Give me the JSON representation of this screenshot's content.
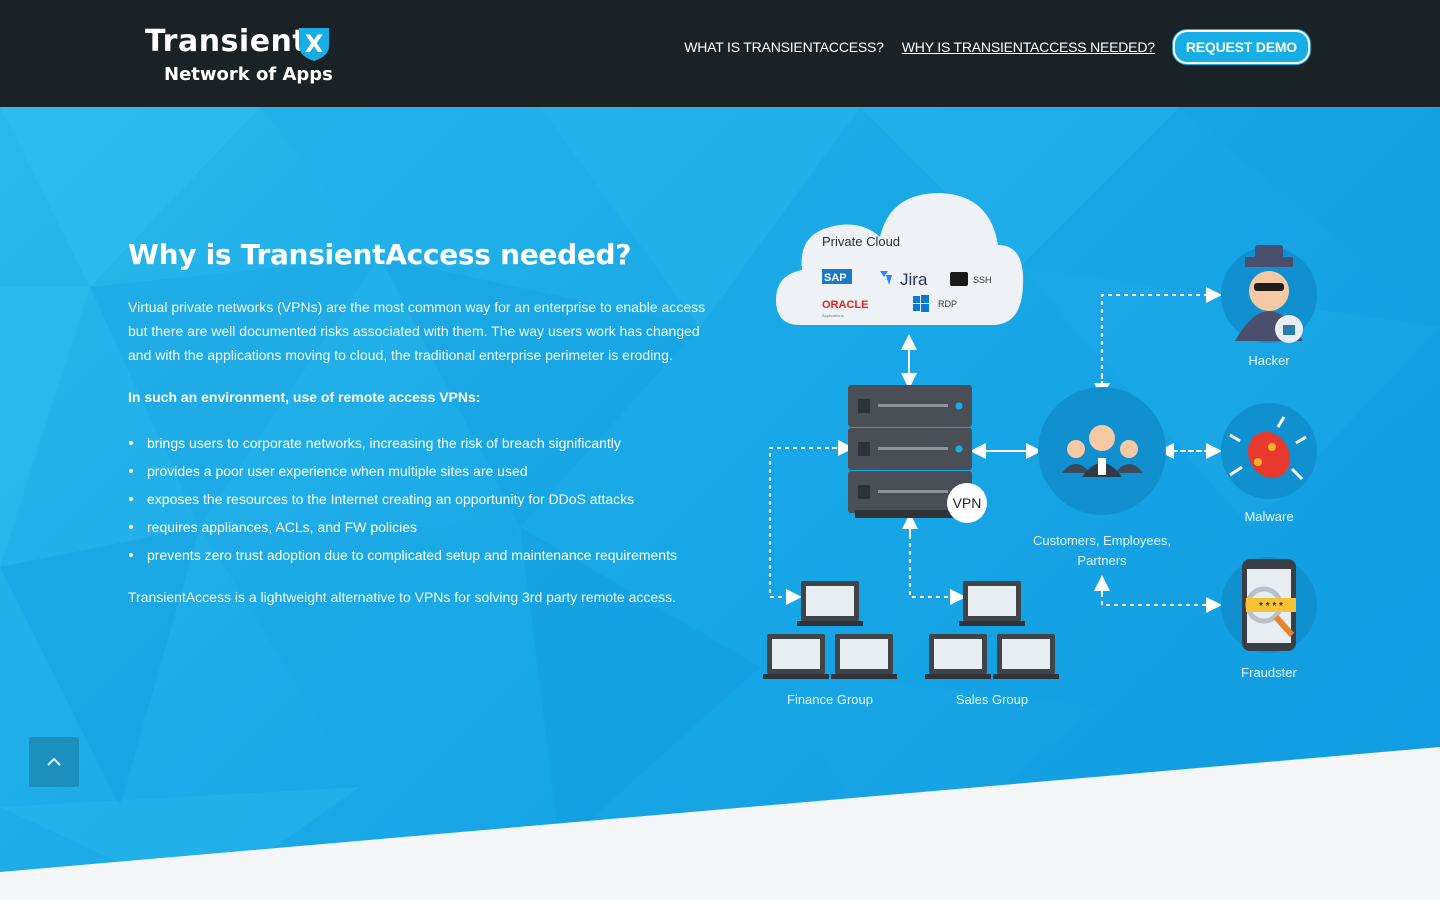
{
  "brand": {
    "name": "Transient",
    "x_mark": "X",
    "tagline": "Network of Apps"
  },
  "nav": {
    "items": [
      {
        "label": "WHAT IS TRANSIENTACCESS?"
      },
      {
        "label": "WHY IS TRANSIENTACCESS NEEDED?"
      }
    ],
    "cta": "REQUEST DEMO"
  },
  "section": {
    "title": "Why is TransientAccess needed?",
    "intro": "Virtual private networks (VPNs) are the most common way for an enterprise to enable access but there are well documented risks associated with them. The way users work has changed and with the applications moving to cloud, the traditional enterprise perimeter is eroding.",
    "subhead": "In such an environment, use of remote access VPNs:",
    "bullets": [
      "brings users to corporate networks, increasing the risk of breach significantly",
      "provides a poor user experience when multiple sites are used",
      "exposes the resources to the Internet creating an opportunity for DDoS attacks",
      "requires appliances, ACLs, and FW policies",
      "prevents zero trust adoption due to complicated setup and maintenance requirements"
    ],
    "closing": "TransientAccess is a lightweight alternative to VPNs for solving 3rd party remote access."
  },
  "diagram": {
    "cloud_title": "Private Cloud",
    "apps": {
      "sap": "SAP",
      "jira": "Jira",
      "ssh": "SSH",
      "oracle": "ORACLE",
      "oracle_sub": "Applications",
      "rdp": "RDP"
    },
    "vpn_label": "VPN",
    "users_label_1": "Customers, Employees,",
    "users_label_2": "Partners",
    "hacker_label": "Hacker",
    "malware_label": "Malware",
    "fraudster_label": "Fraudster",
    "finance_label": "Finance Group",
    "sales_label": "Sales Group",
    "password_mask": "* * * *"
  },
  "colors": {
    "header": "#1b2226",
    "accent": "#17aee6",
    "hero": "#18a7e6",
    "footer": "#f5f6f7"
  },
  "scroll_top_icon": "chevron-up-icon"
}
